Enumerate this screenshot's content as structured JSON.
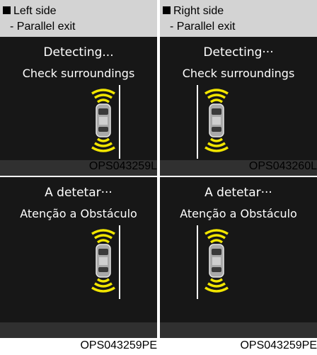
{
  "panels": [
    {
      "header_title": "Left side",
      "header_sub": "- Parallel exit",
      "line1": "Detecting...",
      "line2": "Check surroundings",
      "code": "OPS043259L"
    },
    {
      "header_title": "Right side",
      "header_sub": "- Parallel exit",
      "line1": "Detecting···",
      "line2": "Check surroundings",
      "code": "OPS043260L"
    },
    {
      "line1": "A detetar···",
      "line2": "Atenção a Obstáculo",
      "code": "OPS043259PE"
    },
    {
      "line1": "A detetar···",
      "line2": "Atenção a Obstáculo",
      "code": "OPS043259PE"
    }
  ],
  "colors": {
    "screen_bg": "#171717",
    "header_bg": "#d3d3d3",
    "sensor_yellow": "#f2e600",
    "car_body": "#a9a9a9"
  }
}
